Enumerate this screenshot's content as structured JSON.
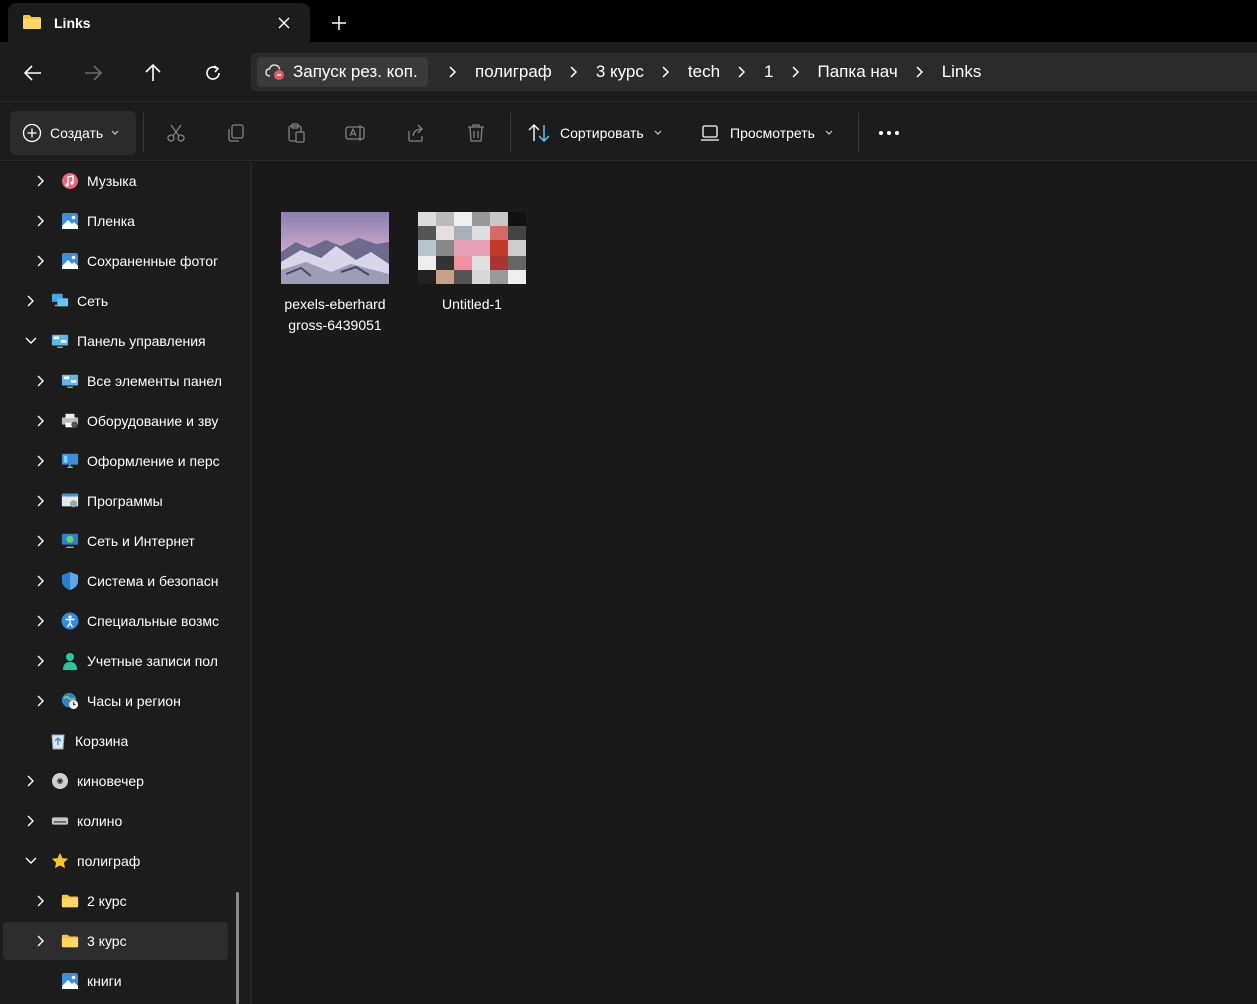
{
  "window": {
    "tab_title": "Links",
    "tab_icon": "folder-icon"
  },
  "nav": {
    "back": "arrow-left-icon",
    "forward": "arrow-right-icon",
    "up": "arrow-up-icon",
    "refresh": "refresh-icon"
  },
  "address": {
    "root_label": "Запуск рез. коп.",
    "root_icon": "cloud-backup-icon",
    "crumbs": [
      "полиграф",
      "3 курс",
      "tech",
      "1",
      "Папка нач",
      "Links"
    ]
  },
  "toolbar": {
    "create_label": "Создать",
    "sort_label": "Сортировать",
    "view_label": "Просмотреть",
    "more_icon": "more-icon"
  },
  "sidebar": {
    "items": [
      {
        "label": "Музыка",
        "icon": "music-icon"
      },
      {
        "label": "Пленка",
        "icon": "pictures-icon"
      },
      {
        "label": "Сохраненные фотог",
        "icon": "pictures-icon"
      },
      {
        "label": "Сеть",
        "icon": "network-icon"
      },
      {
        "label": "Панель управления",
        "icon": "control-panel-icon"
      },
      {
        "label": "Все элементы панел",
        "icon": "control-panel-icon"
      },
      {
        "label": "Оборудование и зву",
        "icon": "printer-icon"
      },
      {
        "label": "Оформление и перс",
        "icon": "display-icon"
      },
      {
        "label": "Программы",
        "icon": "programs-icon"
      },
      {
        "label": "Сеть и Интернет",
        "icon": "globe-network-icon"
      },
      {
        "label": "Система и безопасн",
        "icon": "shield-icon"
      },
      {
        "label": "Специальные возмс",
        "icon": "accessibility-icon"
      },
      {
        "label": "Учетные записи пол",
        "icon": "user-icon"
      },
      {
        "label": "Часы и регион",
        "icon": "clock-globe-icon"
      },
      {
        "label": "Корзина",
        "icon": "recycle-bin-icon"
      },
      {
        "label": "киновечер",
        "icon": "disc-icon"
      },
      {
        "label": "колино",
        "icon": "drive-icon"
      },
      {
        "label": "полиграф",
        "icon": "star-icon"
      },
      {
        "label": "2 курс",
        "icon": "folder-icon"
      },
      {
        "label": "3 курс",
        "icon": "folder-icon"
      },
      {
        "label": "книги",
        "icon": "pictures-icon"
      }
    ]
  },
  "files": [
    {
      "name": "pexels-eberhard gross-6439051",
      "icon": "image-thumbnail-mountain"
    },
    {
      "name": "Untitled-1",
      "icon": "image-thumbnail-collage"
    }
  ],
  "colors": {
    "background": "#191919",
    "panel": "#1c1c1c",
    "folder": "#f5c542",
    "accent": "#60cdff"
  }
}
